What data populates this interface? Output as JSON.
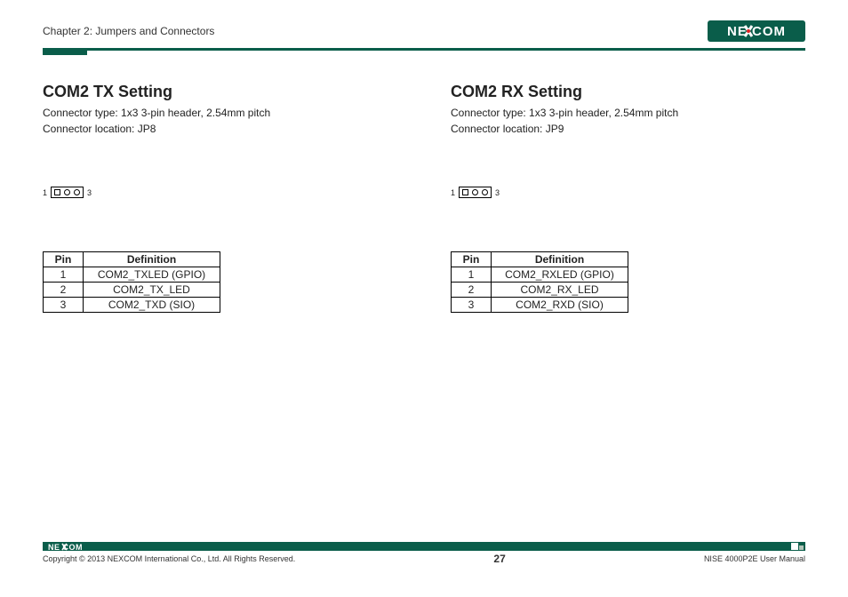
{
  "header": {
    "chapter": "Chapter 2: Jumpers and Connectors",
    "logo_text": "NEXCOM"
  },
  "left": {
    "title": "COM2 TX Setting",
    "type_line": "Connector type: 1x3 3-pin header, 2.54mm pitch",
    "loc_line": "Connector location: JP8",
    "pin_left": "1",
    "pin_right": "3",
    "table": {
      "headers": {
        "pin": "Pin",
        "def": "Definition"
      },
      "rows": [
        {
          "pin": "1",
          "def": "COM2_TXLED (GPIO)"
        },
        {
          "pin": "2",
          "def": "COM2_TX_LED"
        },
        {
          "pin": "3",
          "def": "COM2_TXD (SIO)"
        }
      ]
    }
  },
  "right": {
    "title": "COM2 RX Setting",
    "type_line": "Connector type: 1x3 3-pin header, 2.54mm pitch",
    "loc_line": "Connector location: JP9",
    "pin_left": "1",
    "pin_right": "3",
    "table": {
      "headers": {
        "pin": "Pin",
        "def": "Definition"
      },
      "rows": [
        {
          "pin": "1",
          "def": "COM2_RXLED (GPIO)"
        },
        {
          "pin": "2",
          "def": "COM2_RX_LED"
        },
        {
          "pin": "3",
          "def": "COM2_RXD (SIO)"
        }
      ]
    }
  },
  "footer": {
    "copyright": "Copyright © 2013 NEXCOM International Co., Ltd. All Rights Reserved.",
    "page": "27",
    "manual": "NISE 4000P2E User Manual"
  }
}
